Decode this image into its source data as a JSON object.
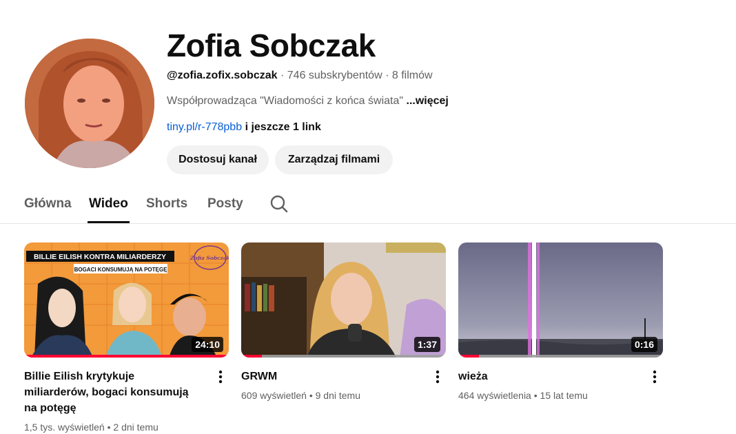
{
  "channel": {
    "name": "Zofia Sobczak",
    "handle": "@zofia.zofix.sobczak",
    "sep1": "·",
    "subscribers": "746 subskrybentów",
    "sep2": "·",
    "videos_count": "8 filmów",
    "description": "Współprowadząca \"Wiadomości z końca świata\"",
    "more": "...więcej",
    "link": "tiny.pl/r-778pbb",
    "link_extra": "i jeszcze 1 link"
  },
  "buttons": {
    "customize": "Dostosuj kanał",
    "manage": "Zarządzaj filmami"
  },
  "tabs": [
    {
      "label": "Główna"
    },
    {
      "label": "Wideo"
    },
    {
      "label": "Shorts"
    },
    {
      "label": "Posty"
    }
  ],
  "active_tab": "Wideo",
  "videos": [
    {
      "title": "Billie Eilish krytykuje miliarderów, bogaci konsumują na potęgę",
      "views": "1,5 tys. wyświetleń",
      "sep": "•",
      "age": "2 dni temu",
      "duration": "24:10",
      "progress_fraction": 1.0,
      "thumb_text_top": "BILLIE EILISH KONTRA MILIARDERZY",
      "thumb_text_sub": "BOGACI KONSUMUJĄ NA POTĘGĘ",
      "thumb_logo": "Zofia Sobczak"
    },
    {
      "title": "GRWM",
      "views": "609 wyświetleń",
      "sep": "•",
      "age": "9 dni temu",
      "duration": "1:37",
      "progress_fraction": 0.1
    },
    {
      "title": "wieża",
      "views": "464 wyświetlenia",
      "sep": "•",
      "age": "15 lat temu",
      "duration": "0:16",
      "progress_fraction": 0.1
    }
  ],
  "colors": {
    "accent_red": "#ff0033",
    "link_blue": "#065fd4",
    "button_bg": "#f2f2f2"
  }
}
